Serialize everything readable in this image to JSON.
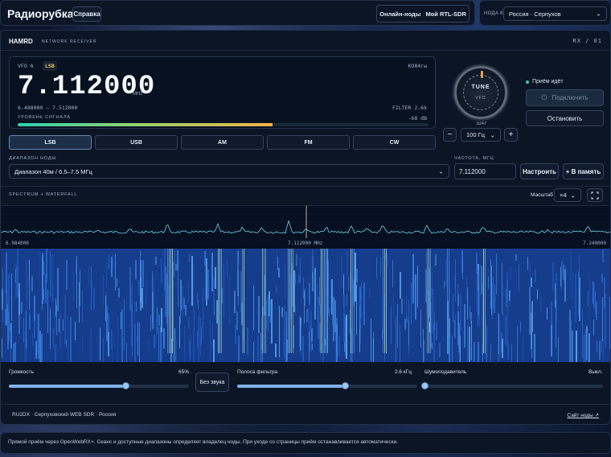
{
  "app": {
    "brand": "Радиорубка",
    "help": "Справка",
    "nav": [
      "Онлайн-ноды",
      "Мой RTL-SDR"
    ],
    "node_label": "НОДА 8",
    "node_select": "Россия · Серпухов"
  },
  "header": {
    "title": "HAMRD",
    "subtitle": "NETWORK RECEIVER",
    "rx": "RX / 01"
  },
  "vfo": {
    "label": "VFO A",
    "mode": "LSB",
    "locator": "KO84гы",
    "frequency": "7.112000",
    "unit": "MHz",
    "range": "6.488000 – 7.512000",
    "filter": "FILTER 2.6k",
    "signal_label": "УРОВЕНЬ СИГНАЛА",
    "signal_db": "-68 dB",
    "signal_level": 0.62
  },
  "knob": {
    "tune": "TUNE",
    "vfo": "VFO",
    "step_label": "ШАГ",
    "minus": "−",
    "plus": "+",
    "step_value": "100 Гц"
  },
  "status": {
    "text": "Приём идёт",
    "connect": "Подключить",
    "stop": "Остановить"
  },
  "modes": [
    "LSB",
    "USB",
    "AM",
    "FM",
    "CW"
  ],
  "band": {
    "label": "ДИАПАЗОН НОДЫ",
    "value": "Диапазон 40м / 6.5–7.5 МГц"
  },
  "freq_input": {
    "label": "ЧАСТОТА, МГЦ",
    "value": "7.112000",
    "set": "Настроить",
    "memory": "+ В память"
  },
  "spectrum": {
    "title": "SPECTRUM + WATERFALL",
    "zoom_label": "Масштаб",
    "zoom_value": "×4",
    "ticks": [
      "6.984000",
      "7.112000 MHz",
      "7.240000"
    ]
  },
  "controls": {
    "volume_label": "Громкость",
    "volume_value": "65%",
    "volume": 0.65,
    "mute": "Без звука",
    "filter_label": "Полоса фильтра",
    "filter_value": "2.6 кГц",
    "filter": 0.6,
    "nr_label": "Шумоподавитель",
    "nr_value": "Выкл.",
    "nr": 0.0
  },
  "footer": {
    "text": "RU2DX · Серпуховский WEB SDR · Россия",
    "link": "Сайт ноды ↗"
  },
  "note": "Прямой приём через OpenWebRX+. Сеанс и доступные диапазоны определяет владелец ноды. При уходе со страницы приём останавливается автоматически.",
  "colors": {
    "accent": "#7fb1e8",
    "status_ok": "#3ecf8e",
    "mode_badge": "#e9c46a",
    "knob_tick": "#f29b45"
  }
}
